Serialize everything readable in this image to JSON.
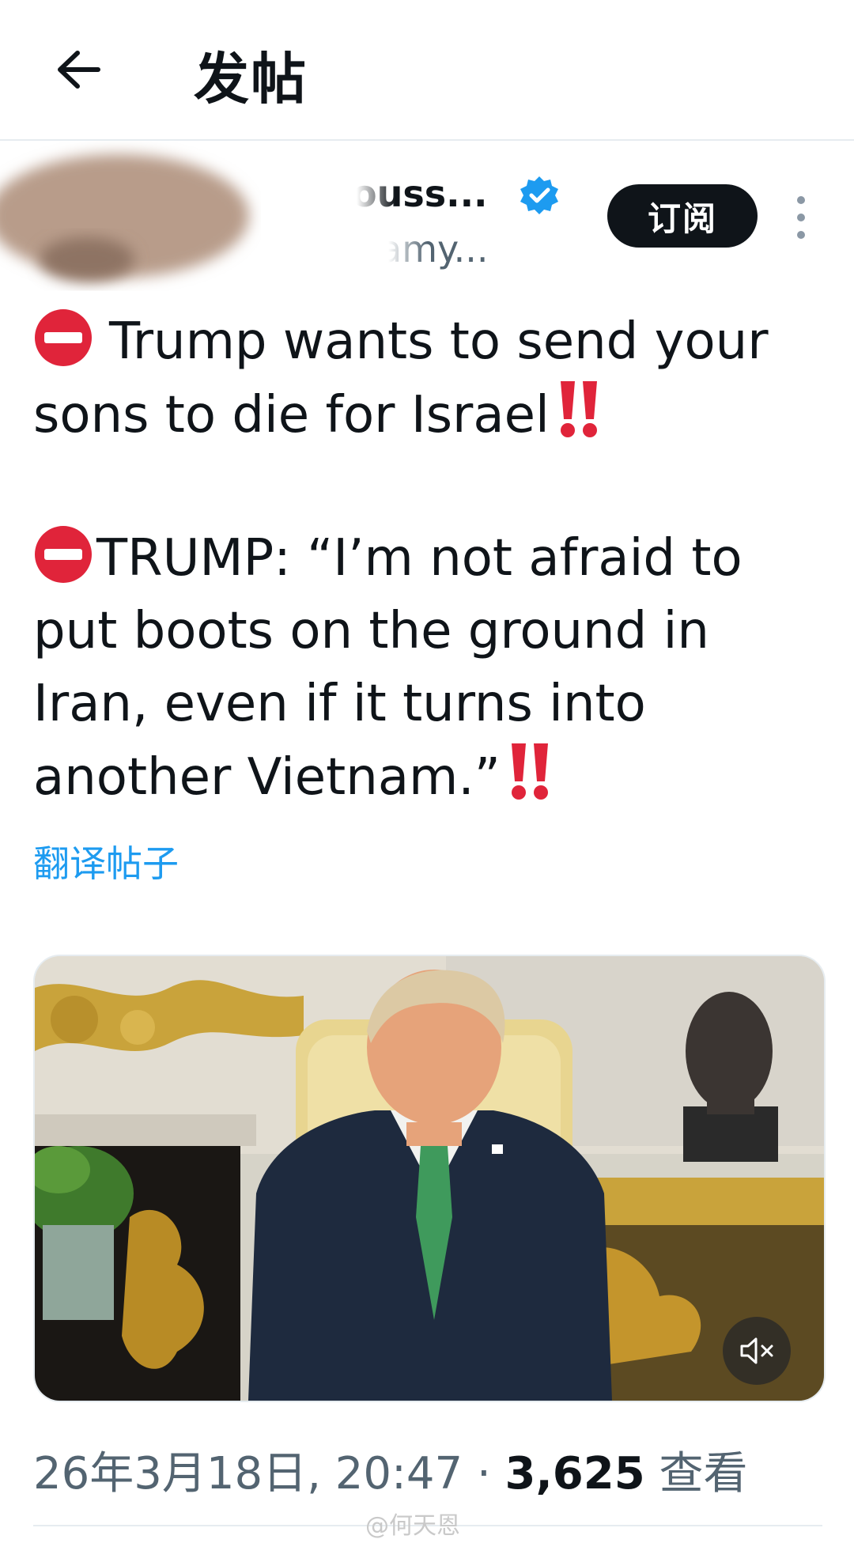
{
  "header": {
    "title": "发帖"
  },
  "author": {
    "name_fragment": "ouss...",
    "handle_fragment": "amy...",
    "subscribe_label": "订阅"
  },
  "post": {
    "paragraph1": "Trump wants to send your sons to die for Israel",
    "paragraph2": "TRUMP: “I’m not afraid to put boots on the ground in Iran, even if it turns into another Vietnam.”",
    "translate_label": "翻译帖子"
  },
  "meta": {
    "datetime": "26年3月18日, 20:47",
    "separator": " · ",
    "views": "3,625",
    "views_label": "查看"
  },
  "watermark": "@何天恩",
  "colors": {
    "accent": "#1d9bf0",
    "text": "#0f1419",
    "secondary": "#536471",
    "emoji_red": "#e0243a"
  }
}
